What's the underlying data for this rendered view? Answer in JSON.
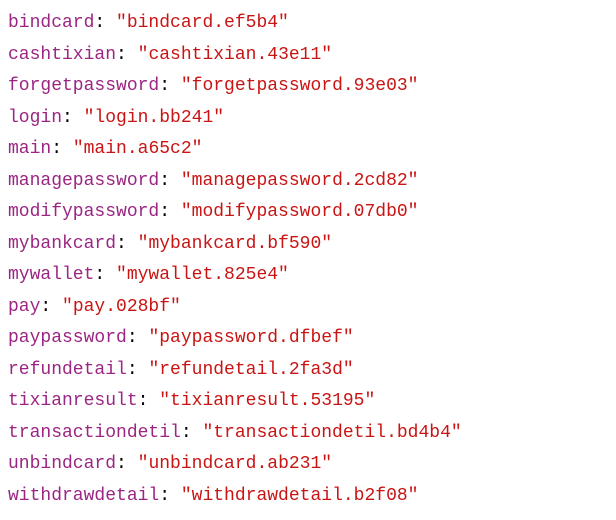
{
  "entries": [
    {
      "key": "bindcard",
      "value": "\"bindcard.ef5b4\""
    },
    {
      "key": "cashtixian",
      "value": "\"cashtixian.43e11\""
    },
    {
      "key": "forgetpassword",
      "value": "\"forgetpassword.93e03\""
    },
    {
      "key": "login",
      "value": "\"login.bb241\""
    },
    {
      "key": "main",
      "value": "\"main.a65c2\""
    },
    {
      "key": "managepassword",
      "value": "\"managepassword.2cd82\""
    },
    {
      "key": "modifypassword",
      "value": "\"modifypassword.07db0\""
    },
    {
      "key": "mybankcard",
      "value": "\"mybankcard.bf590\""
    },
    {
      "key": "mywallet",
      "value": "\"mywallet.825e4\""
    },
    {
      "key": "pay",
      "value": "\"pay.028bf\""
    },
    {
      "key": "paypassword",
      "value": "\"paypassword.dfbef\""
    },
    {
      "key": "refundetail",
      "value": "\"refundetail.2fa3d\""
    },
    {
      "key": "tixianresult",
      "value": "\"tixianresult.53195\""
    },
    {
      "key": "transactiondetil",
      "value": "\"transactiondetil.bd4b4\""
    },
    {
      "key": "unbindcard",
      "value": "\"unbindcard.ab231\""
    },
    {
      "key": "withdrawdetail",
      "value": "\"withdrawdetail.b2f08\""
    }
  ]
}
